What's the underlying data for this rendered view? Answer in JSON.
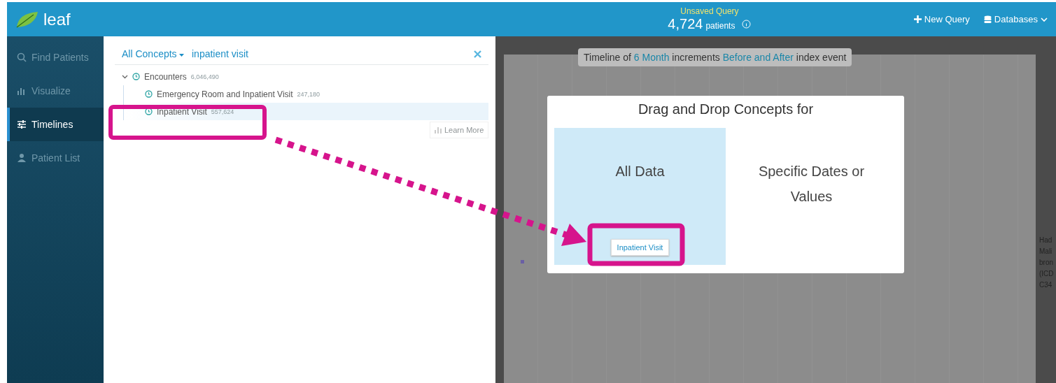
{
  "header": {
    "logo_text": "leaf",
    "query_title": "Unsaved Query",
    "patient_count": "4,724",
    "patient_label": "patients",
    "actions": [
      {
        "label": "New Query",
        "kind": "plus"
      },
      {
        "label": "Databases",
        "kind": "database"
      }
    ]
  },
  "sidebar": {
    "items": [
      {
        "label": "Find Patients",
        "kind": "search",
        "selected": false
      },
      {
        "label": "Visualize",
        "kind": "chart",
        "selected": false
      },
      {
        "label": "Timelines",
        "kind": "timeline",
        "selected": true
      },
      {
        "label": "Patient List",
        "kind": "person",
        "selected": false
      }
    ]
  },
  "concept_panel": {
    "scope": "All Concepts",
    "search_value": "inpatient visit",
    "tree": [
      {
        "label": "Encounters",
        "count": "6,046,490",
        "expanded": true,
        "children": [
          {
            "label": "Emergency Room and Inpatient Visit",
            "count": "247,180",
            "selected": false
          },
          {
            "label": "Inpatient Visit",
            "count": "557,624",
            "selected": true
          }
        ]
      }
    ],
    "learn_more": "Learn More"
  },
  "timeline": {
    "banner": [
      {
        "text": "Timeline of",
        "highlight": false
      },
      {
        "text": "6 Month",
        "highlight": true
      },
      {
        "text": "increments",
        "highlight": false
      },
      {
        "text": "Before and After",
        "highlight": true
      },
      {
        "text": "index event",
        "highlight": false
      }
    ],
    "side_labels": [
      "Had",
      "Mali",
      "bron",
      "(ICD",
      "C34"
    ]
  },
  "modal": {
    "title": "Drag and Drop Concepts for",
    "zones": [
      {
        "label": "All Data",
        "selected": true,
        "chips": [
          "Inpatient Visit"
        ]
      },
      {
        "label": "Specific Dates or Values",
        "selected": false
      }
    ]
  }
}
